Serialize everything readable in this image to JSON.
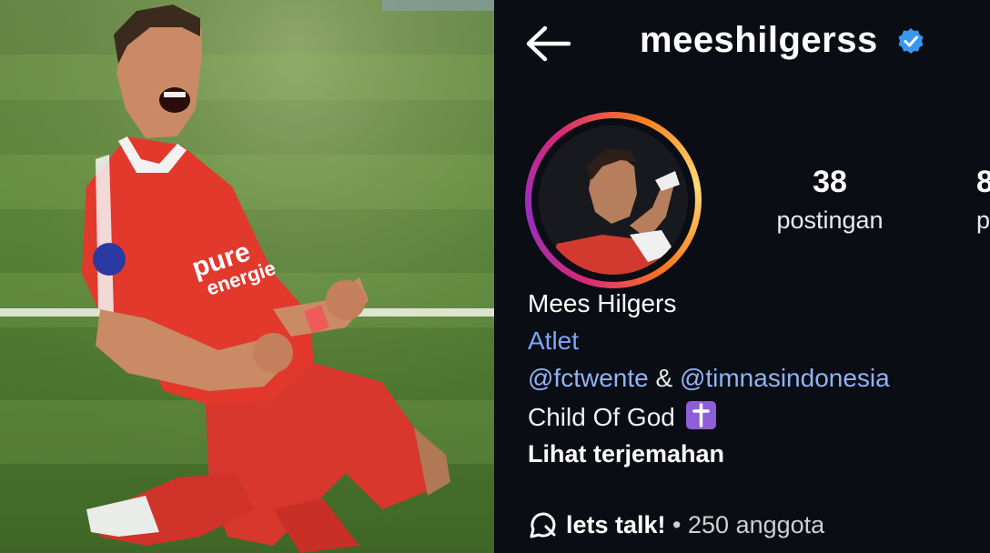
{
  "profile": {
    "username": "meeshilgerss",
    "stats": [
      {
        "value": "38",
        "label": "postingan"
      },
      {
        "value": "8",
        "label": "p"
      }
    ],
    "display_name": "Mees Hilgers",
    "category": "Atlet",
    "mention1": "@fctwente",
    "connector": " & ",
    "mention2": "@timnasindonesia",
    "bio_line": "Child Of God",
    "translate_link": "Lihat terjemahan",
    "channel": {
      "name": "lets talk!",
      "separator": " • ",
      "members": "250 anggota"
    }
  },
  "colors": {
    "background": "#0b0d14",
    "link": "#7aa7f7",
    "verified": "#3897f0",
    "jersey": "#e8382c"
  },
  "icons": [
    "back-arrow-icon",
    "verified-badge-icon",
    "cross-emoji-icon",
    "broadcast-channel-icon"
  ]
}
